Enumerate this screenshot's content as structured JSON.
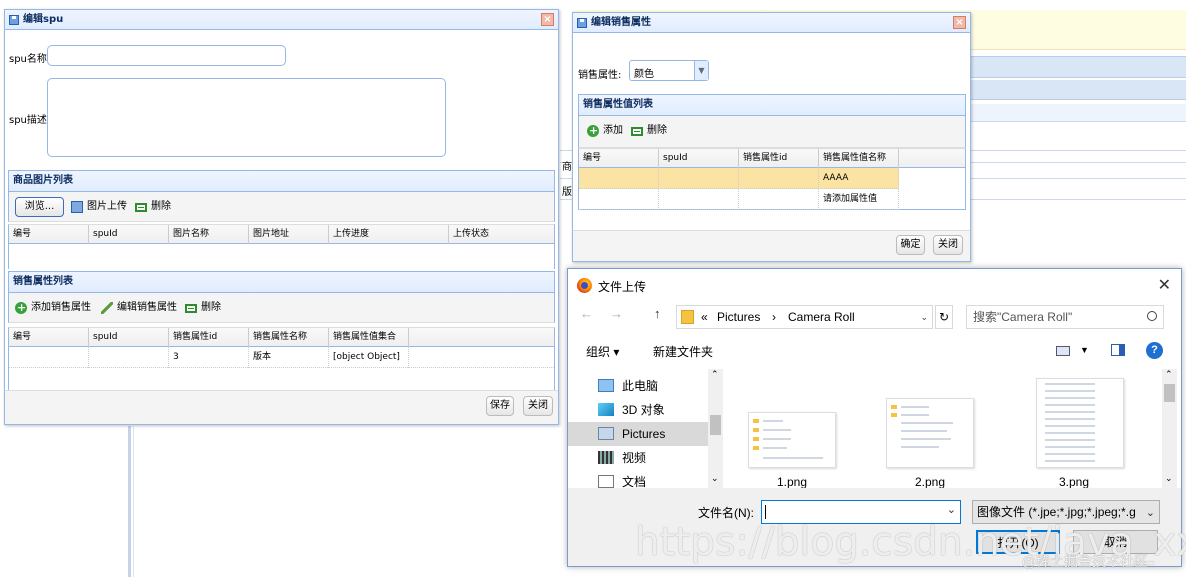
{
  "background": {
    "partial_header_1": "商",
    "partial_header_2": "版"
  },
  "spu_dialog": {
    "title": "编辑spu",
    "close_glyph": "×",
    "name_label": "spu名称:",
    "name_value": "",
    "desc_label": "spu描述:",
    "desc_value": "",
    "image_panel_title": "商品图片列表",
    "image_toolbar": {
      "browse": "浏览...",
      "upload": "图片上传",
      "delete": "删除"
    },
    "image_columns": [
      "编号",
      "spuId",
      "图片名称",
      "图片地址",
      "上传进度",
      "上传状态"
    ],
    "attr_panel_title": "销售属性列表",
    "attr_toolbar": {
      "add": "添加销售属性",
      "edit": "编辑销售属性",
      "delete": "删除"
    },
    "attr_columns": [
      "编号",
      "spuId",
      "销售属性id",
      "销售属性名称",
      "销售属性值集合"
    ],
    "attr_rows": [
      [
        "",
        "",
        "3",
        "版本",
        "[object Object]"
      ]
    ],
    "buttons": {
      "save": "保存",
      "close": "关闭"
    }
  },
  "attr_dialog": {
    "title": "编辑销售属性",
    "close_glyph": "×",
    "attr_label": "销售属性:",
    "attr_select": "颜色",
    "value_panel_title": "销售属性值列表",
    "toolbar": {
      "add": "添加",
      "delete": "删除"
    },
    "columns": [
      "编号",
      "spuId",
      "销售属性id",
      "销售属性值名称"
    ],
    "rows": [
      [
        "",
        "",
        "",
        "AAAA"
      ],
      [
        "",
        "",
        "",
        "请添加属性值"
      ]
    ],
    "buttons": {
      "ok": "确定",
      "close": "关闭"
    }
  },
  "file_dialog": {
    "title": "文件上传",
    "close_glyph": "✕",
    "nav": {
      "back": "←",
      "forward": "→",
      "up": "↑",
      "refresh": "↻"
    },
    "address": {
      "prefix": "«",
      "crumb1": "Pictures",
      "sep": "›",
      "crumb2": "Camera Roll"
    },
    "search_placeholder": "搜索\"Camera Roll\"",
    "toolbar": {
      "organize": "组织 ▾",
      "new_folder": "新建文件夹",
      "help": "?"
    },
    "sidebar": [
      {
        "label": "此电脑",
        "icon": "computer-icon"
      },
      {
        "label": "3D 对象",
        "icon": "3d-objects-icon"
      },
      {
        "label": "Pictures",
        "icon": "pictures-folder-icon"
      },
      {
        "label": "视频",
        "icon": "video-icon"
      },
      {
        "label": "文档",
        "icon": "document-icon"
      }
    ],
    "files": [
      {
        "name": "1.png"
      },
      {
        "name": "2.png"
      },
      {
        "name": "3.png"
      }
    ],
    "filename_label": "文件名(N):",
    "filename_value": "",
    "filetype": "图像文件 (*.jpe;*.jpg;*.jpeg;*.g",
    "open_button": "打开(O)",
    "cancel_button": "取消",
    "colors": {
      "selection": "#d9d9d9",
      "accent": "#0078d7"
    }
  },
  "watermark": {
    "url": "https://blog.csdn.net/java_xxid",
    "site": "@稀土掘金技术社区"
  },
  "colors": {
    "easyui_border": "#95b8e7",
    "highlight_row": "#fbe3a4"
  }
}
